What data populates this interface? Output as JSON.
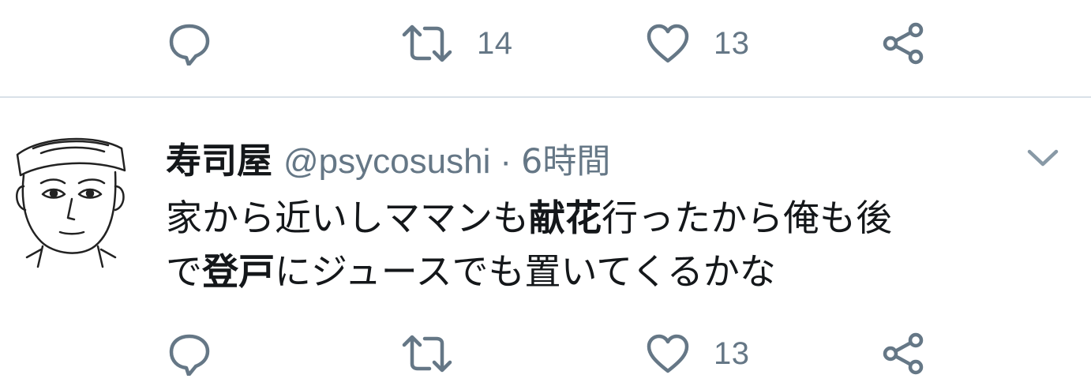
{
  "colors": {
    "icon": "#657786",
    "divider": "#d9e1e8",
    "text": "#14171a",
    "secondary": "#657786"
  },
  "top_actions": {
    "reply_icon": "reply-icon",
    "retweet_icon": "retweet-icon",
    "retweet_count": "14",
    "like_icon": "heart-icon",
    "like_count": "13",
    "share_icon": "share-icon"
  },
  "tweet": {
    "display_name": "寿司屋",
    "handle": "@psycosushi",
    "separator": "·",
    "timestamp": "6時間",
    "menu_icon": "chevron-down-icon",
    "body": {
      "line1_part1": "家から近いしママンも",
      "line1_bold": "献花",
      "line1_part2": "行ったから俺も後",
      "line2_part1": "で",
      "line2_bold": "登戸",
      "line2_part2": "にジュースでも置いてくるかな"
    },
    "actions": {
      "reply_icon": "reply-icon",
      "retweet_icon": "retweet-icon",
      "retweet_count": "",
      "like_icon": "heart-icon",
      "like_count": "13",
      "share_icon": "share-icon"
    }
  }
}
